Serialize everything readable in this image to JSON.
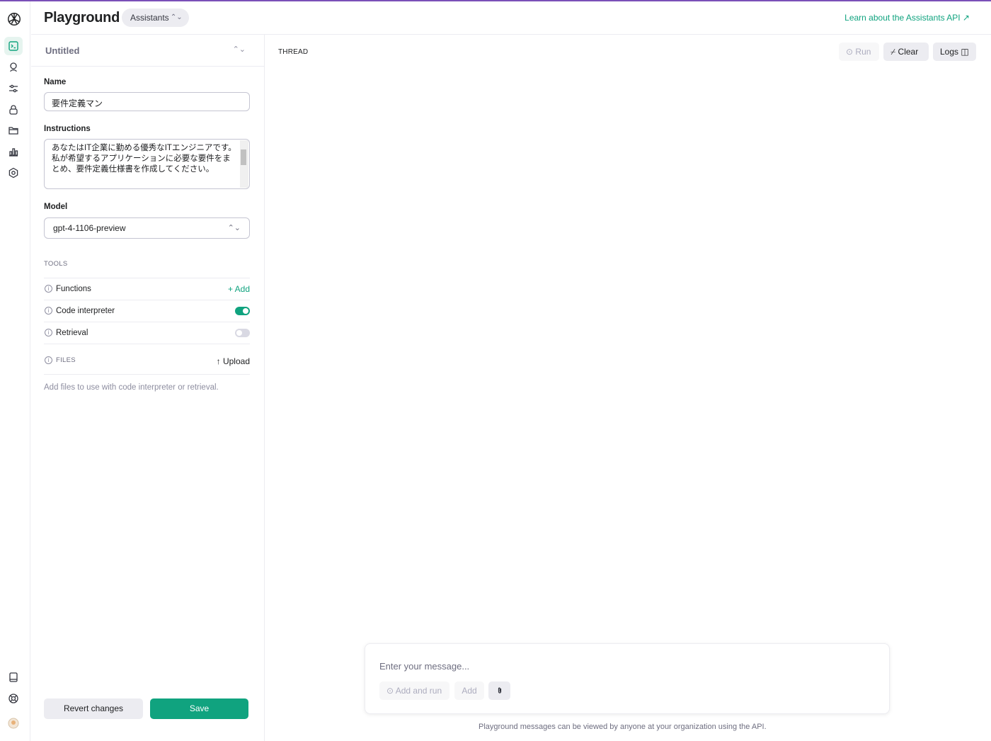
{
  "app": {
    "title": "Playground",
    "mode": "Assistants",
    "learn_link": "Learn about the Assistants API ↗"
  },
  "rail": {
    "icons": [
      "openai-logo-icon",
      "terminal-icon",
      "assistant-robot-icon",
      "sliders-icon",
      "lock-icon",
      "folder-icon",
      "bar-chart-icon",
      "settings-icon",
      "book-icon",
      "help-lifebuoy-icon",
      "user-avatar"
    ]
  },
  "assistant": {
    "selected": "Untitled",
    "name_label": "Name",
    "name_value": "要件定義マン",
    "instructions_label": "Instructions",
    "instructions_value": "あなたはIT企業に勤める優秀なITエンジニアです。\n私が希望するアプリケーションに必要な要件をまとめ、要件定義仕様書を作成してください。",
    "model_label": "Model",
    "model_value": "gpt-4-1106-preview"
  },
  "tools": {
    "caption": "TOOLS",
    "functions_label": "Functions",
    "add_label": "Add",
    "code_interpreter_label": "Code interpreter",
    "code_interpreter_enabled": true,
    "retrieval_label": "Retrieval",
    "retrieval_enabled": false
  },
  "files": {
    "caption": "FILES",
    "upload_label": "Upload",
    "hint": "Add files to use with code interpreter or retrieval."
  },
  "actions": {
    "revert": "Revert changes",
    "save": "Save"
  },
  "thread": {
    "caption": "THREAD",
    "run": "Run",
    "clear": "Clear",
    "logs": "Logs"
  },
  "composer": {
    "placeholder": "Enter your message...",
    "add_and_run": "Add and run",
    "add": "Add",
    "note": "Playground messages can be viewed by anyone at your organization using the API."
  },
  "colors": {
    "accent": "#10a37f",
    "border": "#ececf1"
  }
}
